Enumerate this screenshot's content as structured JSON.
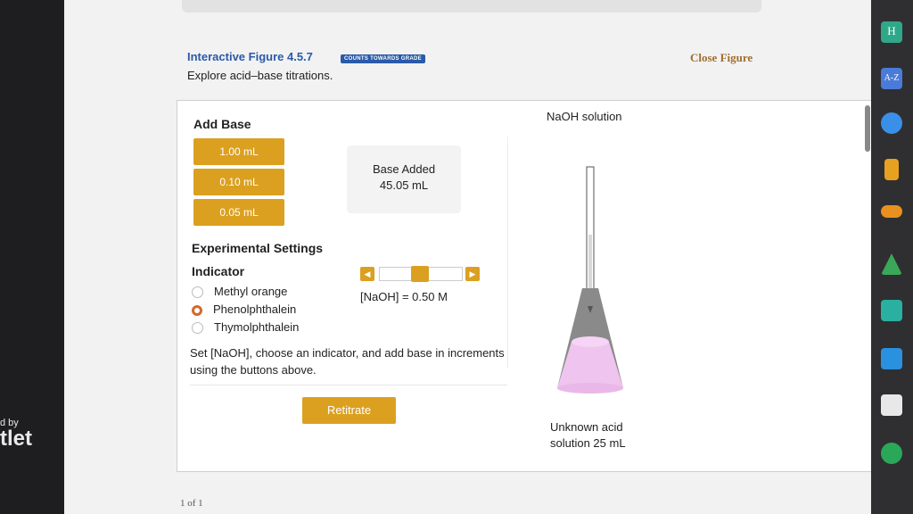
{
  "figure": {
    "title": "Interactive Figure 4.5.7",
    "grade_badge": "COUNTS TOWARDS GRADE",
    "close_label": "Close Figure",
    "subtitle": "Explore acid–base titrations."
  },
  "add_base": {
    "title": "Add Base",
    "buttons": [
      "1.00 mL",
      "0.10 mL",
      "0.05 mL"
    ]
  },
  "base_added": {
    "label": "Base Added",
    "value": "45.05 mL"
  },
  "settings": {
    "title": "Experimental Settings",
    "indicator_title": "Indicator",
    "indicators": [
      "Methyl orange",
      "Phenolphthalein",
      "Thymolphthalein"
    ],
    "selected_indicator": "Phenolphthalein",
    "naoh_concentration": "[NaOH] = 0.50 M",
    "naoh_slider_fraction": 0.5
  },
  "instructions": "Set [NaOH], choose an indicator, and add base in increments using the buttons above.",
  "retitrate_label": "Retitrate",
  "apparatus": {
    "burette_label": "NaOH solution",
    "flask_label_line1": "Unknown acid",
    "flask_label_line2": "solution 25 mL"
  },
  "pager": "1 of 1",
  "left_promo": {
    "small": "d by",
    "big": "tlet"
  },
  "colors": {
    "accent": "#dba020",
    "link": "#2a5aa8",
    "radio_selected": "#d36a2a",
    "solution": "#efc4ee"
  },
  "right_bar_icons": [
    "h-icon",
    "a-z-icon",
    "edge-icon",
    "book-icon",
    "cloud-icon",
    "drive-icon",
    "cart-icon",
    "chat-icon",
    "notes-icon",
    "chrome-icon"
  ]
}
